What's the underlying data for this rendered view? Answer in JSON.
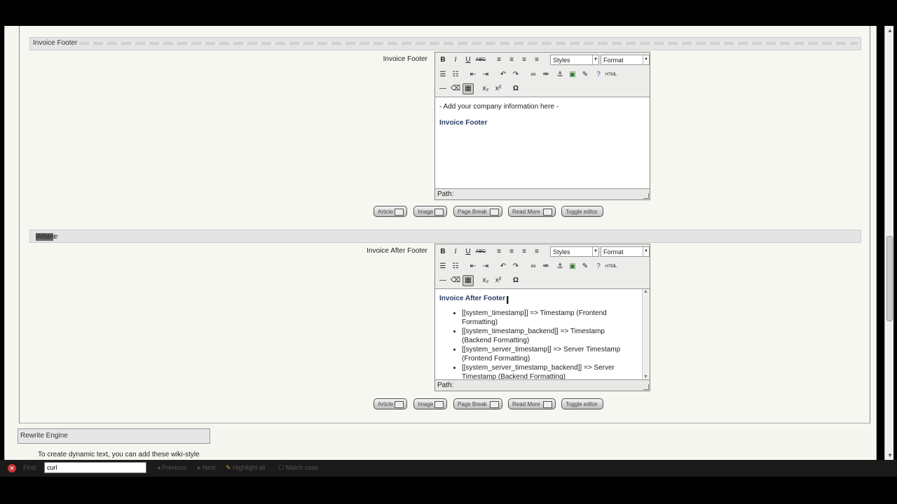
{
  "sections": [
    {
      "header_parts": [
        "Invoice Footer"
      ],
      "field_label": "Invoice Footer"
    },
    {
      "header_parts": [
        "Invoice ",
        "After",
        " Footer"
      ],
      "field_label": "Invoice After Footer"
    }
  ],
  "editor": {
    "styles_label": "Styles",
    "format_label": "Format",
    "path_label": "Path:"
  },
  "editor1": {
    "line1": "- Add your company information here -",
    "title": "Invoice Footer"
  },
  "editor2": {
    "title": "Invoice After Footer",
    "items": [
      "[[system_timestamp]] => Timestamp (Frontend Formatting)",
      "[[system_timestamp_backend]] => Timestamp (Backend Formatting)",
      "[[system_server_timestamp]] => Server Timestamp (Frontend Formatting)",
      "[[system_server_timestamp_backend]] => Server Timestamp (Backend Formatting)"
    ]
  },
  "buttons": [
    "Article",
    "Image",
    "Page Break",
    "Read More",
    "Toggle editor"
  ],
  "rewrite": {
    "title": "Rewrite Engine",
    "text": "To create dynamic text, you can add these wiki-style"
  },
  "findbar": {
    "find_label": "Find:",
    "find_value": "curl",
    "previous": "Previous",
    "next": "Next",
    "highlight_all": "Highlight all",
    "match_case": "Match case"
  }
}
